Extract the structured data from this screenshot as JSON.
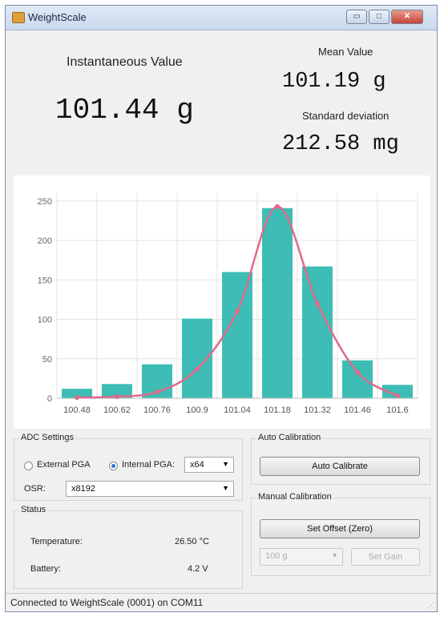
{
  "window": {
    "title": "WeightScale",
    "min_glyph": "▭",
    "max_glyph": "□",
    "close_glyph": "✕"
  },
  "readouts": {
    "instant_label": "Instantaneous Value",
    "instant_value": "101.44",
    "instant_unit": "g",
    "mean_label": "Mean Value",
    "mean_value": "101.19",
    "mean_unit": "g",
    "std_label": "Standard deviation",
    "std_value": "212.58",
    "std_unit": "mg"
  },
  "chart_data": {
    "type": "bar",
    "categories": [
      "100.48",
      "100.62",
      "100.76",
      "100.9",
      "101.04",
      "101.18",
      "101.32",
      "101.46",
      "101.6"
    ],
    "series": [
      {
        "values": [
          12,
          18,
          43,
          101,
          160,
          241,
          167,
          48,
          17
        ],
        "color": "#3dbdb5"
      }
    ],
    "overlay_curve": {
      "type": "line",
      "color": "#e06a8c",
      "points": [
        1,
        2,
        8,
        37,
        110,
        243,
        120,
        33,
        3
      ]
    },
    "ylim": [
      0,
      260
    ],
    "yticks": [
      "0",
      "50",
      "100",
      "150",
      "200",
      "250"
    ],
    "grid": true
  },
  "adc": {
    "group_label": "ADC Settings",
    "external_pga_label": "External PGA",
    "internal_pga_label": "Internal PGA:",
    "pga_selected": "internal",
    "pga_value": "x64",
    "osr_label": "OSR:",
    "osr_value": "x8192"
  },
  "status": {
    "group_label": "Status",
    "temperature_label": "Temperature:",
    "temperature_value": "26.50 °C",
    "battery_label": "Battery:",
    "battery_value": "4.2 V"
  },
  "auto_cal": {
    "group_label": "Auto Calibration",
    "button": "Auto Calibrate"
  },
  "manual_cal": {
    "group_label": "Manual Calibration",
    "offset_button": "Set Offset (Zero)",
    "weight_value": "100 g",
    "gain_button": "Set Gain"
  },
  "statusbar": {
    "text": "Connected to WeightScale (0001) on COM11"
  }
}
